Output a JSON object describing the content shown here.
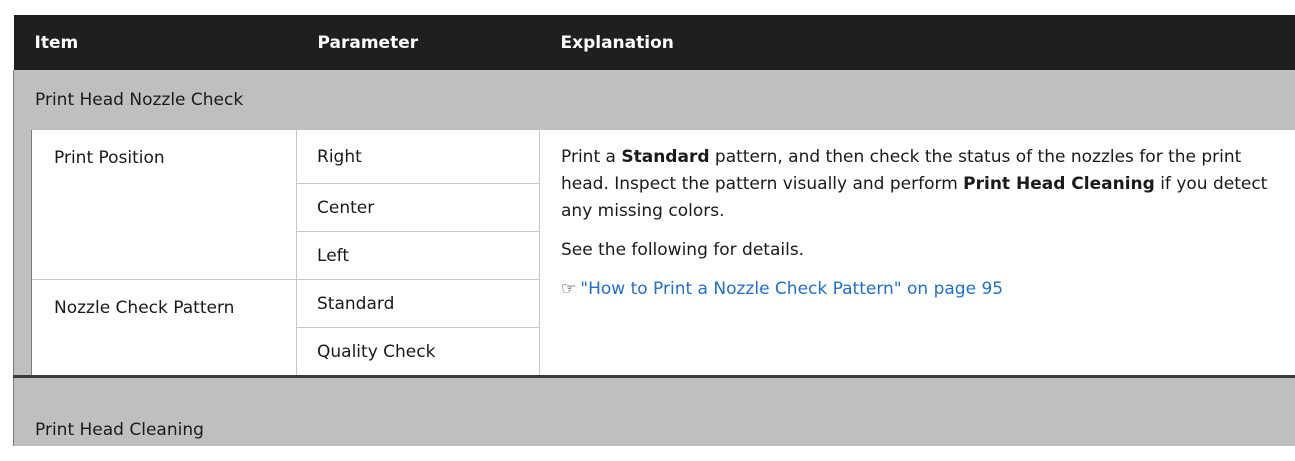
{
  "header": {
    "item": "Item",
    "parameter": "Parameter",
    "explanation": "Explanation"
  },
  "sections": [
    {
      "title": "Print Head Nozzle Check"
    },
    {
      "title": "Print Head Cleaning"
    }
  ],
  "rows": {
    "print_position": {
      "label": "Print Position",
      "params": [
        "Right",
        "Center",
        "Left"
      ]
    },
    "nozzle_check_pattern": {
      "label": "Nozzle Check Pattern",
      "params": [
        "Standard",
        "Quality Check"
      ]
    }
  },
  "explanation": {
    "p1_a": "Print a ",
    "p1_b": "Standard",
    "p1_c": " pattern, and then check the status of the nozzles for the print head. Inspect the pattern visually and perform ",
    "p1_d": "Print Head Cleaning",
    "p1_e": " if you detect any missing colors.",
    "p2": "See the following for details.",
    "link_icon": "hand-pointer-icon",
    "link": "\"How to Print a Nozzle Check Pattern\" on page 95"
  },
  "colors": {
    "header_bg": "#1f1f1f",
    "section_bg": "#bfbfbf",
    "link": "#1f6fd1"
  }
}
